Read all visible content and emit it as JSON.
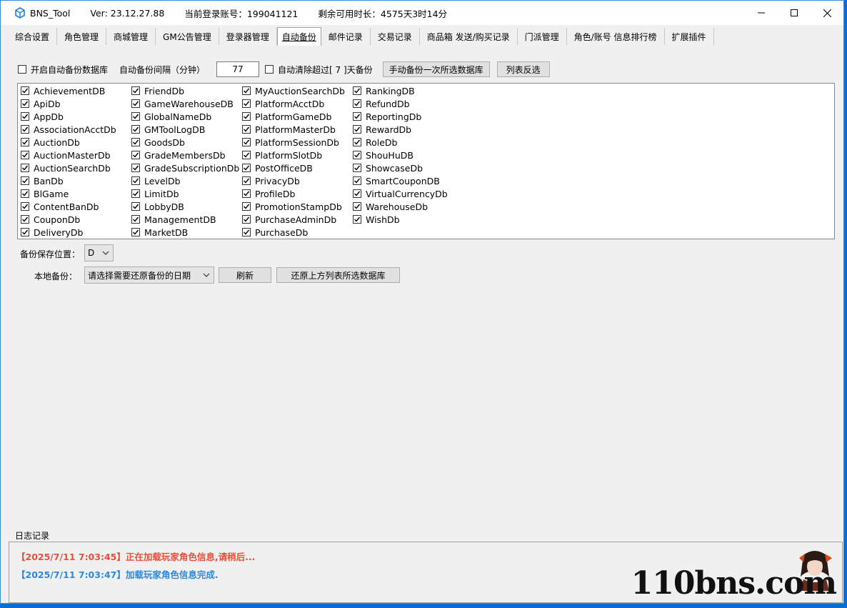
{
  "titlebar": {
    "app_name": "BNS_Tool",
    "version": "Ver:  23.12.27.88",
    "account": "当前登录账号：199041121",
    "remaining": "剩余可用时长：4575天3时14分"
  },
  "tabs": [
    {
      "label": "综合设置"
    },
    {
      "label": "角色管理"
    },
    {
      "label": "商城管理"
    },
    {
      "label": "GM公告管理"
    },
    {
      "label": "登录器管理"
    },
    {
      "label": "自动备份",
      "active": true
    },
    {
      "label": "邮件记录"
    },
    {
      "label": "交易记录"
    },
    {
      "label": "商品箱 发送/购买记录"
    },
    {
      "label": "门派管理"
    },
    {
      "label": "角色/账号 信息排行榜"
    },
    {
      "label": "扩展插件"
    }
  ],
  "backup": {
    "auto_enable_label": "开启自动备份数据库",
    "interval_label": "自动备份间隔（分钟）",
    "interval_value": "77",
    "auto_clean_label": "自动清除超过[ 7 ]天备份",
    "manual_button": "手动备份一次所选数据库",
    "invert_button": "列表反选"
  },
  "databases": {
    "col1": [
      "AchievementDB",
      "ApiDb",
      "AppDb",
      "AssociationAcctDb",
      "AuctionDb",
      "AuctionMasterDb",
      "AuctionSearchDb",
      "BanDb",
      "BlGame",
      "ContentBanDb",
      "CouponDb",
      "DeliveryDb"
    ],
    "col2": [
      "FriendDb",
      "GameWarehouseDB",
      "GlobalNameDb",
      "GMToolLogDB",
      "GoodsDb",
      "GradeMembersDb",
      "GradeSubscriptionDb",
      "LevelDb",
      "LimitDb",
      "LobbyDB",
      "ManagementDB",
      "MarketDB"
    ],
    "col3": [
      "MyAuctionSearchDb",
      "PlatformAcctDb",
      "PlatformGameDb",
      "PlatformMasterDb",
      "PlatformSessionDb",
      "PlatformSlotDb",
      "PostOfficeDB",
      "PrivacyDb",
      "ProfileDb",
      "PromotionStampDb",
      "PurchaseAdminDb",
      "PurchaseDb"
    ],
    "col4": [
      "RankingDB",
      "RefundDb",
      "ReportingDb",
      "RewardDb",
      "RoleDb",
      "ShouHuDB",
      "ShowcaseDb",
      "SmartCouponDB",
      "VirtualCurrencyDb",
      "WarehouseDb",
      "WishDb"
    ]
  },
  "save_location": {
    "label": "备份保存位置：",
    "value": "D"
  },
  "local_backup": {
    "label": "本地备份：",
    "select_value": "请选择需要还原备份的日期",
    "refresh_button": "刷新",
    "restore_button": "还原上方列表所选数据库"
  },
  "log": {
    "title": "日志记录",
    "lines": [
      {
        "text": "【2025/7/11 7:03:45】正在加载玩家角色信息,请稍后...",
        "color": "#e8503a"
      },
      {
        "text": "【2025/7/11 7:03:47】加载玩家角色信息完成.",
        "color": "#2a88e0"
      }
    ]
  },
  "watermark": "110bns.com",
  "colors": {
    "accent": "#0a6cd6",
    "log_warning": "#e8503a",
    "log_info": "#2a88e0"
  }
}
